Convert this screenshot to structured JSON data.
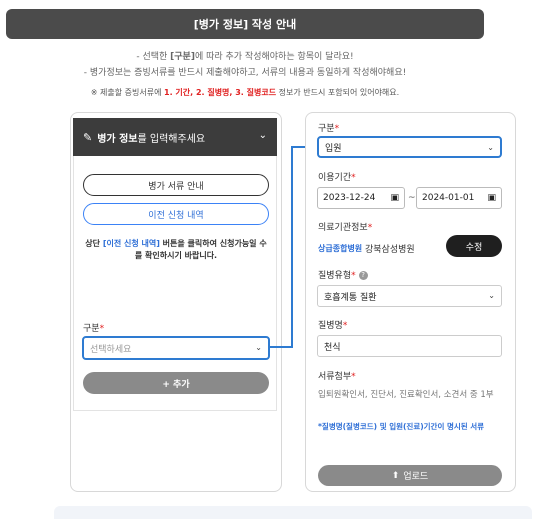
{
  "header": {
    "title": "[병가 정보] 작성 안내"
  },
  "notes": {
    "line1_prefix": "- 선택한 ",
    "line1_bold": "[구분]",
    "line1_suffix": "에 따라 추가 작성해야하는 항목이 달라요!",
    "line2": "- 병가정보는 증빙서류를 반드시 제출해야하고, 서류의 내용과 동일하게 작성해야해요!",
    "line3_prefix": "※ 제출할 증빙서류에 ",
    "line3_red": "1. 기간, 2. 질병명, 3. 질병코드",
    "line3_suffix": " 정보가 반드시 포함되어 있어야해요."
  },
  "left_panel": {
    "title_bold": "병가 정보",
    "title_rest": "를 입력해주세요",
    "guide_button": "병가 서류 안내",
    "history_button": "이전 신청 내역",
    "hint_prefix": "상단 ",
    "hint_link": "[이전 신청 내역]",
    "hint_suffix": " 버튼을 클릭하여 신청가능일 수를 확인하시기 바랍니다.",
    "category_label": "구분",
    "category_placeholder": "선택하세요",
    "add_button": "+ 추가"
  },
  "right_panel": {
    "category_label": "구분",
    "category_value": "입원",
    "period_label": "이용기간",
    "start_date": "2023-12-24",
    "end_date": "2024-01-01",
    "period_separator": "~",
    "hospital_label": "의료기관정보",
    "hospital_type": "상급종합병원",
    "hospital_name": "강북삼성병원",
    "edit_button": "수정",
    "disease_type_label": "질병유형",
    "disease_type_value": "호흡계통 질환",
    "disease_name_label": "질병명",
    "disease_name_value": "천식",
    "doc_label": "서류첨부",
    "doc_desc": "입퇴원확인서, 진단서, 진료확인서, 소견서 중 1부",
    "doc_note": "*질병명(질병코드) 및 입원(진료)기간이 명시된 서류",
    "upload_button": "업로드"
  },
  "required_mark": "*",
  "icons": {
    "pen": "pencil-icon",
    "chevron": "chevron-down-icon",
    "calendar": "calendar-icon",
    "help": "help-circle-icon",
    "upload": "upload-icon"
  },
  "colors": {
    "accent_blue": "#2e7bd1",
    "required_red": "#e02020",
    "header_dark": "#4b4b4b"
  }
}
